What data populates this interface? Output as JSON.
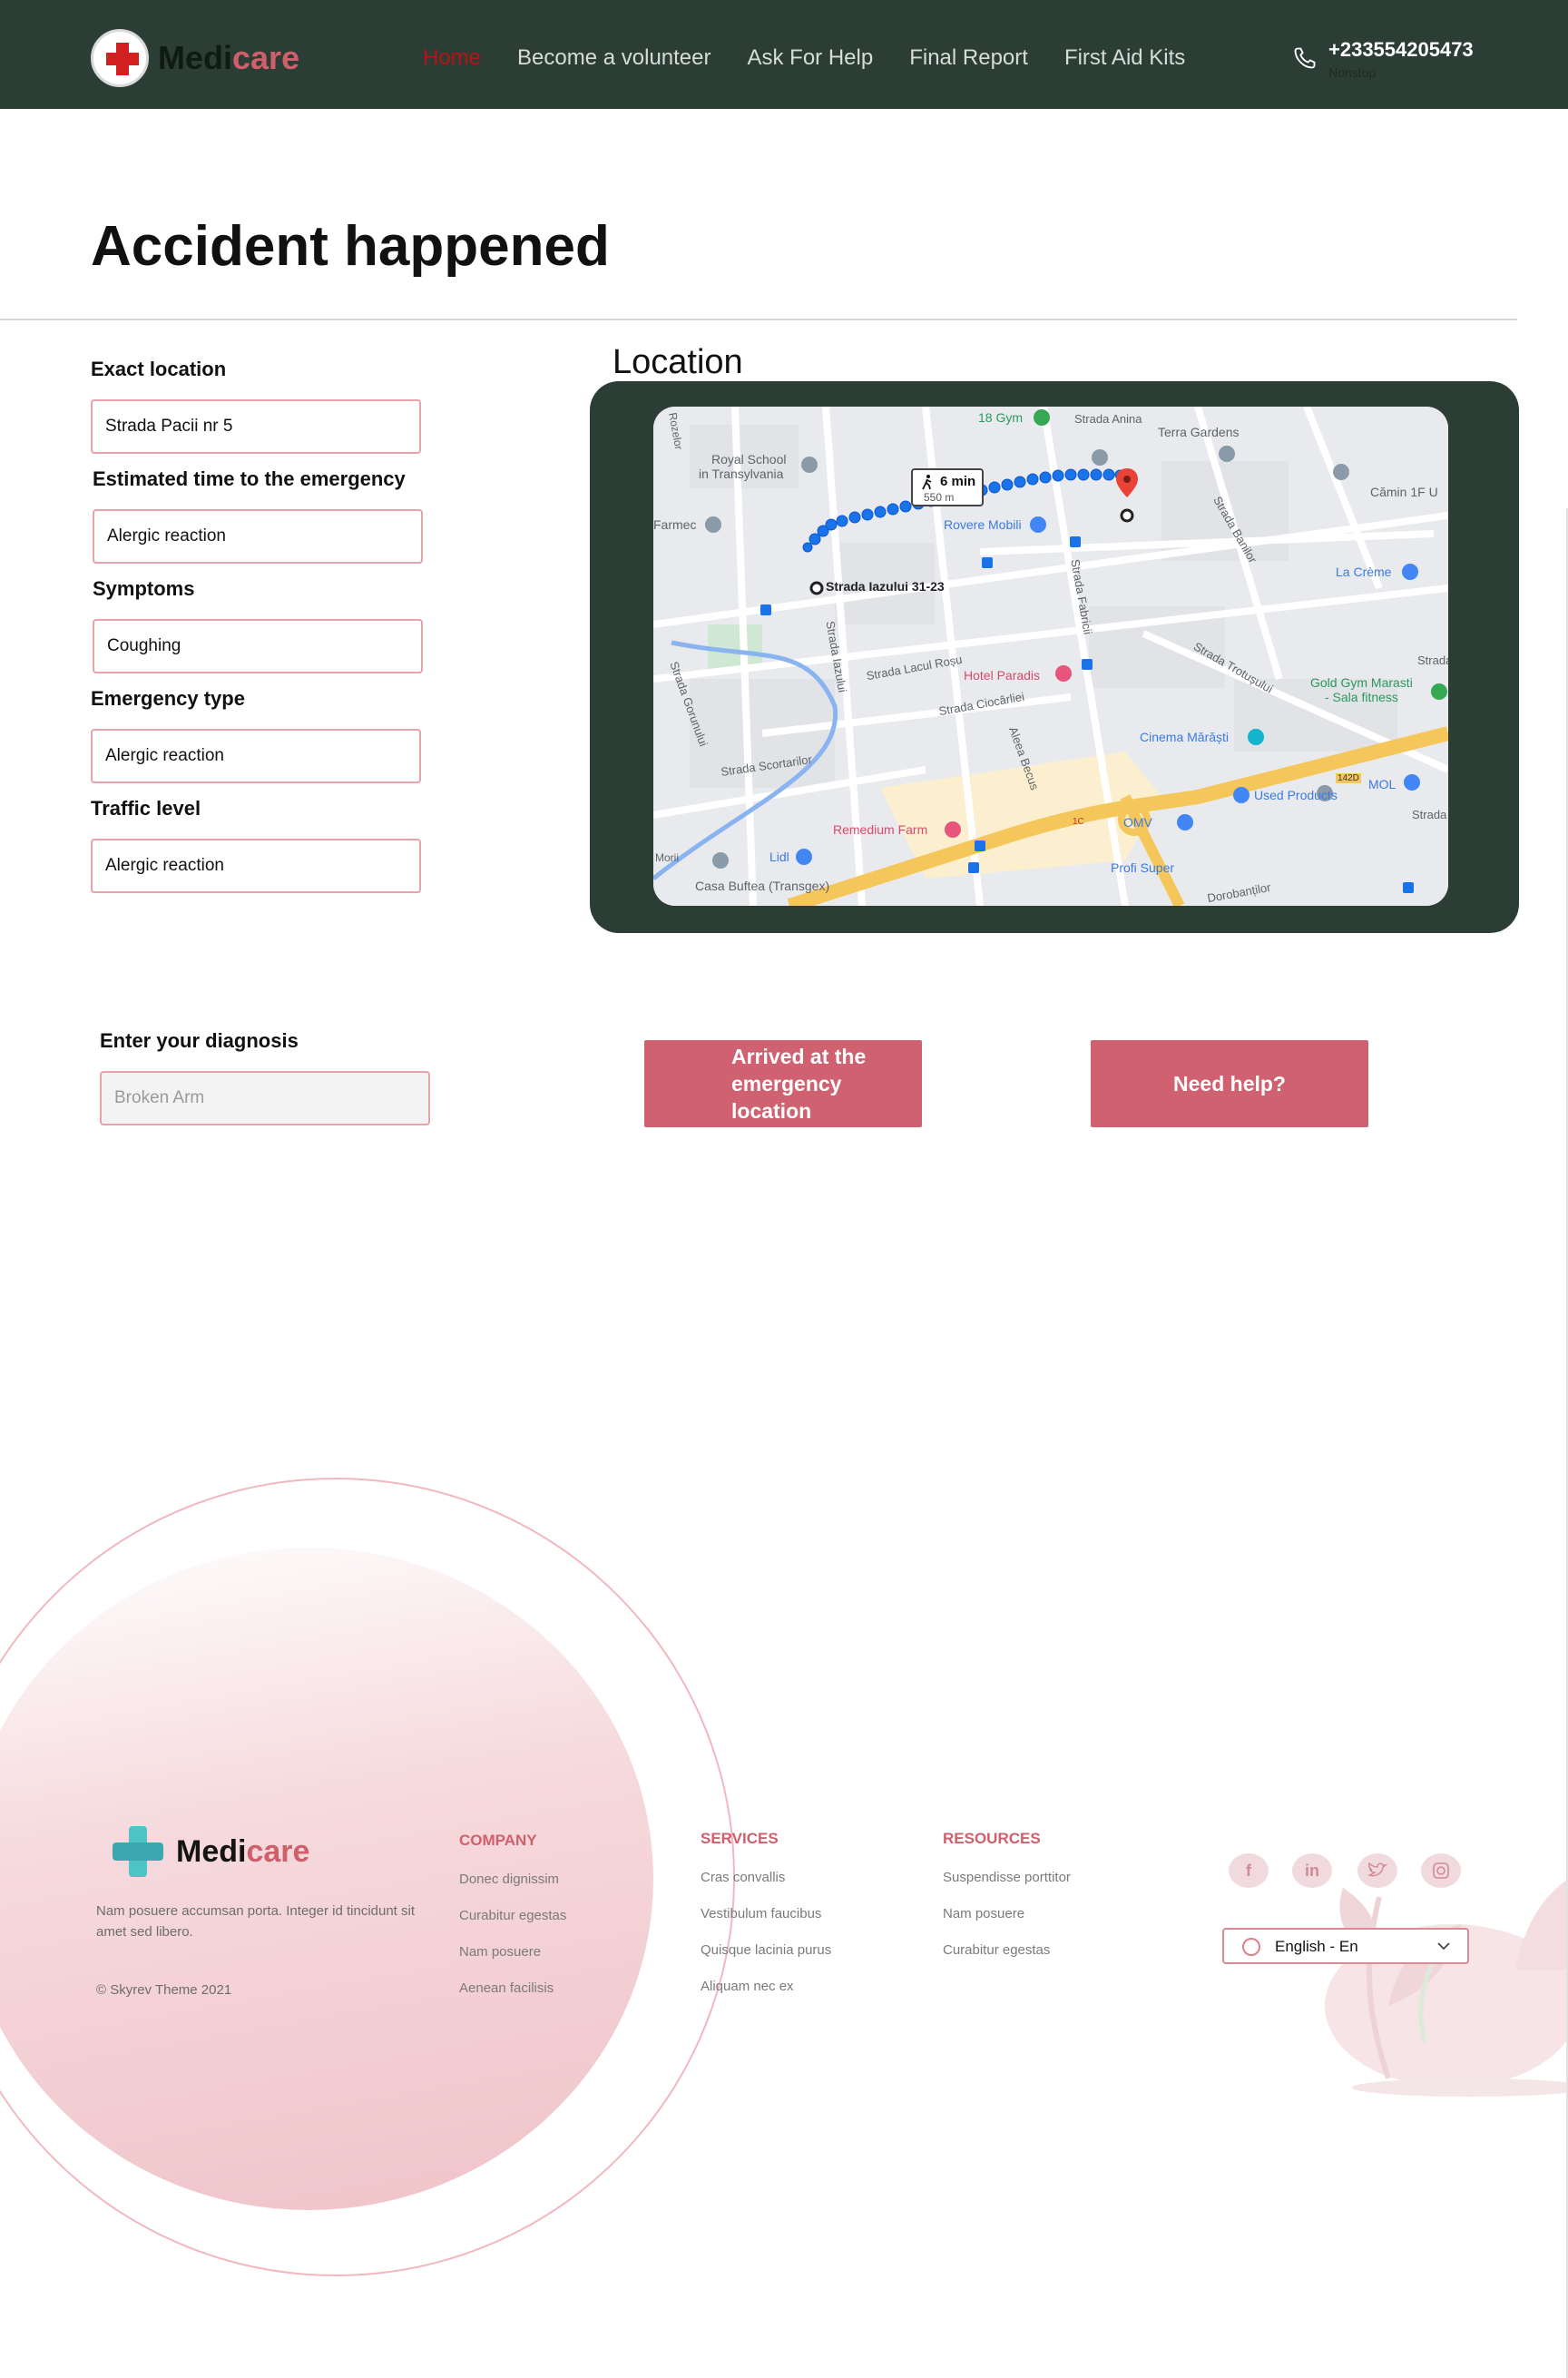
{
  "header": {
    "logo": {
      "part1": "Medi",
      "part2": "care"
    },
    "nav": [
      "Home",
      "Become a volunteer",
      "Ask For Help",
      "Final Report",
      "First Aid Kits"
    ],
    "phone": {
      "number": "+233554205473",
      "sub": "Nonstop"
    }
  },
  "page": {
    "title": "Accident happened",
    "location_title": "Location"
  },
  "form": {
    "fields": [
      {
        "label": "Exact location",
        "value": "Strada Pacii nr 5"
      },
      {
        "label": "Estimated time to the emergency",
        "value": "Alergic reaction"
      },
      {
        "label": "Symptoms",
        "value": "Coughing"
      },
      {
        "label": "Emergency type",
        "value": "Alergic reaction"
      },
      {
        "label": "Traffic level",
        "value": "Alergic reaction"
      }
    ]
  },
  "map": {
    "walk_time": "6 min",
    "walk_distance": "550 m",
    "labels": {
      "gym18": "18 Gym",
      "anina": "Strada Anina",
      "royal1": "Royal School",
      "royal2": "in Transylvania",
      "terra": "Terra Gardens",
      "camin": "Cămin 1F U",
      "farmec": "Farmec",
      "rovere": "Rovere Mobili",
      "banilor": "Strada Banilor",
      "lacreme": "La Crème",
      "start": "Strada Iazului 31-23",
      "fabricii": "Strada Fabricii",
      "iazului": "Strada Iazului",
      "lacul": "Strada Lacul Roșu",
      "paradis": "Hotel Paradis",
      "trotusului": "Strada Trotușului",
      "gold1": "Gold Gym Marasti",
      "gold2": "- Sala fitness",
      "ciocarliei": "Strada Ciocârliei",
      "gorunului": "Strada Gorunului",
      "cinema": "Cinema Mărăști",
      "scortarilor": "Strada Scortarilor",
      "becus": "Aleea Becus",
      "used": "Used Products",
      "mol": "MOL",
      "omv": "OMV",
      "remedium": "Remedium Farm",
      "lidl": "Lidl",
      "profi": "Profi Super",
      "bufteа": "Casa Buftea (Transgex)",
      "morii": "Morii",
      "roz": "Rozelor",
      "strada_r": "Strada",
      "strada_r2": "Strada",
      "dorobantilor": "Dorobanților",
      "road_r1": "1C",
      "road_r2": "142D"
    }
  },
  "diagnosis": {
    "label": "Enter your diagnosis",
    "placeholder": "Broken Arm"
  },
  "buttons": {
    "arrived": "Arrived at the emergency location",
    "help": "Need help?"
  },
  "footer": {
    "logo": {
      "part1": "Medi",
      "part2": "care"
    },
    "description": "Nam posuere accumsan porta. Integer id tincidunt sit amet sed libero.",
    "copyright": "© Skyrev Theme 2021",
    "columns": [
      {
        "title": "COMPANY",
        "links": [
          "Donec dignissim",
          "Curabitur egestas",
          "Nam posuere",
          "Aenean facilisis"
        ]
      },
      {
        "title": "SERVICES",
        "links": [
          "Cras convallis",
          "Vestibulum faucibus",
          "Quisque lacinia purus",
          "Aliquam nec ex"
        ]
      },
      {
        "title": "RESOURCES",
        "links": [
          "Suspendisse porttitor",
          "Nam posuere",
          "Curabitur egestas"
        ]
      }
    ],
    "social": [
      "facebook-icon",
      "linkedin-icon",
      "twitter-icon",
      "instagram-icon"
    ],
    "language": "English - En"
  },
  "colors": {
    "header_bg": "#2b3d35",
    "accent": "#d06170",
    "brand_pink": "#d05f6c"
  }
}
